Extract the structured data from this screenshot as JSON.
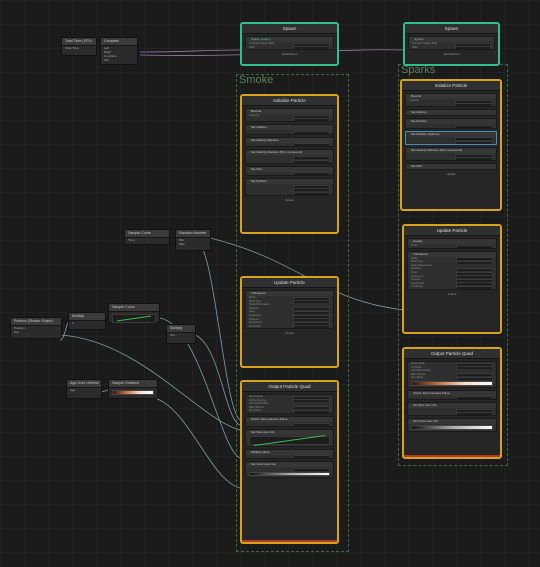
{
  "groups": {
    "smoke": "Smoke",
    "sparks": "Sparks"
  },
  "left_nodes": {
    "total_time": {
      "title": "Total Time (VFX)",
      "row1": "Total Time"
    },
    "compare": {
      "title": "Compare",
      "rows": [
        "Left",
        "Right",
        "Condition",
        "Out"
      ]
    },
    "sample_curve": {
      "title": "Sample Curve",
      "rows": [
        "Curve",
        "Time",
        "s"
      ]
    },
    "add_random": {
      "title": "Random Number",
      "rows": [
        "Min",
        "Max",
        "Seed"
      ]
    },
    "multiply": {
      "title": "Multiply",
      "rows": [
        "A",
        "B",
        "Out"
      ]
    },
    "position_sg": {
      "title": "Position (Shader Graph)",
      "rows": [
        "Position",
        "Out"
      ]
    },
    "sample_gradient": {
      "title": "Sample Gradient",
      "rows": [
        "Gradient",
        "Time"
      ]
    },
    "age_over_lifetime": {
      "title": "Age Over Lifetime",
      "rows": [
        "Age",
        "Lifetime"
      ]
    },
    "sample_gradient2": {
      "title": "Sample Gradient",
      "rows": [
        "Gradient",
        "Time"
      ]
    },
    "random_small": {
      "title": "Random",
      "rows": [
        "Out"
      ]
    }
  },
  "spawn_left": {
    "title": "Spawn",
    "header_tags": [
      "Start",
      "Stop"
    ],
    "block": "Spawn system",
    "rows": [
      "Constant Spawn Rate",
      "Rate"
    ],
    "footer": "SpawnEvent"
  },
  "spawn_right": {
    "title": "Spawn",
    "block": "System",
    "rows": [
      "Constant Spawn Rate",
      "Rate"
    ],
    "footer": "SpawnEvent"
  },
  "init_left": {
    "title": "Initialize Particle",
    "badge": "Particle",
    "rows": [
      "Bounds",
      "Capacity",
      "Set Lifetime",
      "Set Velocity Random",
      "Set Position",
      "Set Velocity Random (Per-component)",
      "Set Size",
      "Set Color"
    ],
    "footer": "Update"
  },
  "init_right": {
    "title": "Initialize Particle",
    "badge": "Particle",
    "rows": [
      "Bounds",
      "Capacity",
      "Set Lifetime",
      "Set Position",
      "Set Velocity Random",
      "Set Position (Sphere)",
      "Set Velocity Random (Per-component)",
      "Set Size"
    ],
    "footer": "Update"
  },
  "update_left": {
    "title": "Update Particle",
    "badge": "Update",
    "rows": [
      "Turbulence",
      "Mode",
      "Field Type",
      "Noise Parameters",
      "Intensity",
      "Drag",
      "Frequency",
      "Octaves",
      "Roughness",
      "Lacunarity"
    ],
    "footer": "Output"
  },
  "update_right": {
    "title": "Update Particle",
    "badge": "Update",
    "rows": [
      "Gravity",
      "Force",
      "Turbulence",
      "Mode",
      "Field Type",
      "Noise Parameters",
      "Intensity",
      "Drag",
      "Frequency",
      "Octaves",
      "Roughness",
      "Lacunarity"
    ],
    "footer": "Output"
  },
  "output_left": {
    "title": "Output Particle Quad",
    "badge": "Output",
    "rows": [
      "Blend Mode",
      "Alpha Clipping",
      "Use Soft Particle",
      "Main Texture",
      "Sort Mode",
      "Orient: Face Camera Plane",
      "Set Size over Life",
      "Set Color over Life",
      "Multiply Alpha",
      "Set Color over Life"
    ],
    "footer": ""
  },
  "output_right": {
    "title": "Output Particle Quad",
    "badge": "Output",
    "rows": [
      "Blend Mode",
      "Uv Mode",
      "Use Soft Particle",
      "Main Texture",
      "Sort Mode",
      "Orient: Face Camera Plane",
      "Set Size over Life",
      "Set Color over Life"
    ],
    "footer": ""
  },
  "colors": {
    "spawn_border": "#2fbf8f",
    "context_border": "#d9a21b",
    "output_bottom": "#b33a2a",
    "wire": "#7da0a8",
    "wire_pink": "#9c7aa6",
    "group_dash": "#3f6a3f"
  }
}
